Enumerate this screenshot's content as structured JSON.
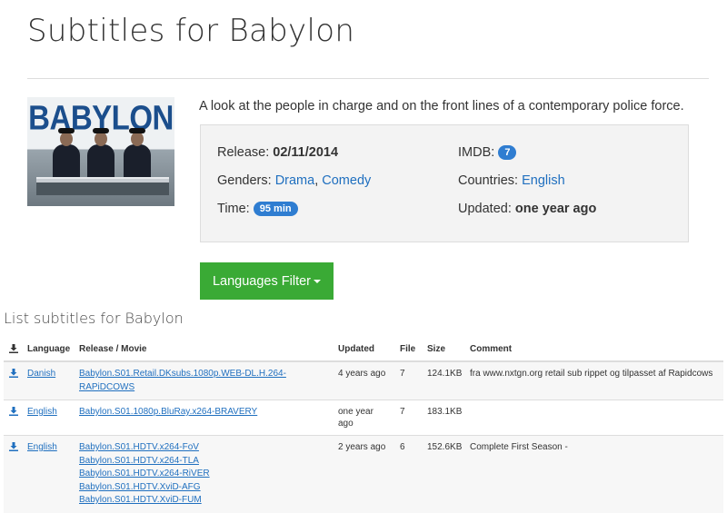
{
  "page": {
    "title": "Subtitles for Babylon"
  },
  "show": {
    "poster_title": "BABYLON",
    "description": "A look at the people in charge and on the front lines of a contemporary police force.",
    "info": {
      "release_label": "Release:",
      "release_value": "02/11/2014",
      "imdb_label": "IMDB:",
      "imdb_value": "7",
      "genders_label": "Genders:",
      "genres": [
        "Drama",
        "Comedy"
      ],
      "countries_label": "Countries:",
      "country": "English",
      "time_label": "Time:",
      "time_value": "95 min",
      "updated_label": "Updated:",
      "updated_value": "one year ago"
    }
  },
  "filter": {
    "button_label": "Languages Filter"
  },
  "list": {
    "title": "List subtitles for Babylon",
    "columns": [
      "Language",
      "Release / Movie",
      "Updated",
      "File",
      "Size",
      "Comment"
    ],
    "rows": [
      {
        "language": "Danish",
        "releases": [
          "Babylon.S01.Retail.DKsubs.1080p.WEB-DL.H.264-RAPiDCOWS"
        ],
        "updated": "4 years ago",
        "file": "7",
        "size": "124.1KB",
        "comment": "fra www.nxtgn.org retail sub rippet og tilpasset af Rapidcows"
      },
      {
        "language": "English",
        "releases": [
          "Babylon.S01.1080p.BluRay.x264-BRAVERY"
        ],
        "updated": "one year ago",
        "file": "7",
        "size": "183.1KB",
        "comment": ""
      },
      {
        "language": "English",
        "releases": [
          "Babylon.S01.HDTV.x264-FoV",
          "Babylon.S01.HDTV.x264-TLA",
          "Babylon.S01.HDTV.x264-RiVER",
          "Babylon.S01.HDTV.XviD-AFG",
          "Babylon.S01.HDTV.XviD-FUM"
        ],
        "updated": "2 years ago",
        "file": "6",
        "size": "152.6KB",
        "comment": "Complete First Season -"
      }
    ]
  },
  "icons": {
    "download": "download-icon",
    "caret": "caret-down-icon"
  },
  "colors": {
    "link": "#1f6fbf",
    "badge": "#2f7dd1",
    "filter_button": "#3aaa35",
    "poster_title": "#1b4e8c"
  }
}
